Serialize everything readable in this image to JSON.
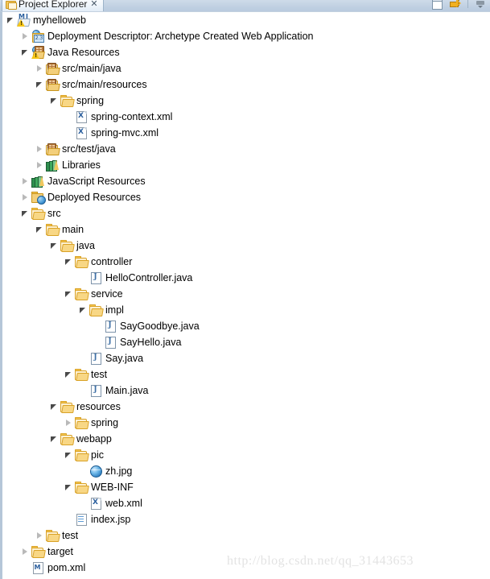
{
  "view": {
    "tab_label": "Project Explorer",
    "tab_close": "✕",
    "tab_icon": "folder-icon",
    "toolbar": {
      "restore_label": "restore-view-icon",
      "link_label": "link-with-editor-icon",
      "menu_label": "view-menu-icon"
    }
  },
  "watermark": "http://blog.csdn.net/qq_31443653",
  "tree": [
    {
      "label": "myhelloweb",
      "depth": 0,
      "twisty": "open",
      "icon": "maven-java-project-icon"
    },
    {
      "label": "Deployment Descriptor: Archetype Created Web Application",
      "depth": 1,
      "twisty": "closed",
      "icon": "deployment-descriptor-icon"
    },
    {
      "label": "Java Resources",
      "depth": 1,
      "twisty": "open",
      "icon": "java-resources-icon"
    },
    {
      "label": "src/main/java",
      "depth": 2,
      "twisty": "closed",
      "icon": "source-folder-icon"
    },
    {
      "label": "src/main/resources",
      "depth": 2,
      "twisty": "open",
      "icon": "source-folder-icon"
    },
    {
      "label": "spring",
      "depth": 3,
      "twisty": "open",
      "icon": "folder-icon"
    },
    {
      "label": "spring-context.xml",
      "depth": 4,
      "twisty": "none",
      "icon": "xml-file-icon"
    },
    {
      "label": "spring-mvc.xml",
      "depth": 4,
      "twisty": "none",
      "icon": "xml-file-icon"
    },
    {
      "label": "src/test/java",
      "depth": 2,
      "twisty": "closed",
      "icon": "source-folder-icon"
    },
    {
      "label": "Libraries",
      "depth": 2,
      "twisty": "closed",
      "icon": "libraries-icon"
    },
    {
      "label": "JavaScript Resources",
      "depth": 1,
      "twisty": "closed",
      "icon": "libraries-icon"
    },
    {
      "label": "Deployed Resources",
      "depth": 1,
      "twisty": "closed",
      "icon": "deployed-resources-icon"
    },
    {
      "label": "src",
      "depth": 1,
      "twisty": "open",
      "icon": "folder-icon"
    },
    {
      "label": "main",
      "depth": 2,
      "twisty": "open",
      "icon": "folder-icon"
    },
    {
      "label": "java",
      "depth": 3,
      "twisty": "open",
      "icon": "folder-icon"
    },
    {
      "label": "controller",
      "depth": 4,
      "twisty": "open",
      "icon": "folder-icon"
    },
    {
      "label": "HelloController.java",
      "depth": 5,
      "twisty": "none",
      "icon": "java-file-icon"
    },
    {
      "label": "service",
      "depth": 4,
      "twisty": "open",
      "icon": "folder-icon"
    },
    {
      "label": "impl",
      "depth": 5,
      "twisty": "open",
      "icon": "folder-icon"
    },
    {
      "label": "SayGoodbye.java",
      "depth": 6,
      "twisty": "none",
      "icon": "java-file-icon"
    },
    {
      "label": "SayHello.java",
      "depth": 6,
      "twisty": "none",
      "icon": "java-file-icon"
    },
    {
      "label": "Say.java",
      "depth": 5,
      "twisty": "none",
      "icon": "java-file-icon"
    },
    {
      "label": "test",
      "depth": 4,
      "twisty": "open",
      "icon": "folder-icon"
    },
    {
      "label": "Main.java",
      "depth": 5,
      "twisty": "none",
      "icon": "java-file-icon"
    },
    {
      "label": "resources",
      "depth": 3,
      "twisty": "open",
      "icon": "folder-icon"
    },
    {
      "label": "spring",
      "depth": 4,
      "twisty": "closed",
      "icon": "folder-icon"
    },
    {
      "label": "webapp",
      "depth": 3,
      "twisty": "open",
      "icon": "folder-icon"
    },
    {
      "label": "pic",
      "depth": 4,
      "twisty": "open",
      "icon": "folder-icon"
    },
    {
      "label": "zh.jpg",
      "depth": 5,
      "twisty": "none",
      "icon": "image-file-icon"
    },
    {
      "label": "WEB-INF",
      "depth": 4,
      "twisty": "open",
      "icon": "folder-icon"
    },
    {
      "label": "web.xml",
      "depth": 5,
      "twisty": "none",
      "icon": "xml-file-icon"
    },
    {
      "label": "index.jsp",
      "depth": 4,
      "twisty": "none",
      "icon": "jsp-file-icon"
    },
    {
      "label": "test",
      "depth": 2,
      "twisty": "closed",
      "icon": "folder-icon"
    },
    {
      "label": "target",
      "depth": 1,
      "twisty": "closed",
      "icon": "folder-icon"
    },
    {
      "label": "pom.xml",
      "depth": 1,
      "twisty": "none",
      "icon": "maven-pom-icon"
    }
  ]
}
